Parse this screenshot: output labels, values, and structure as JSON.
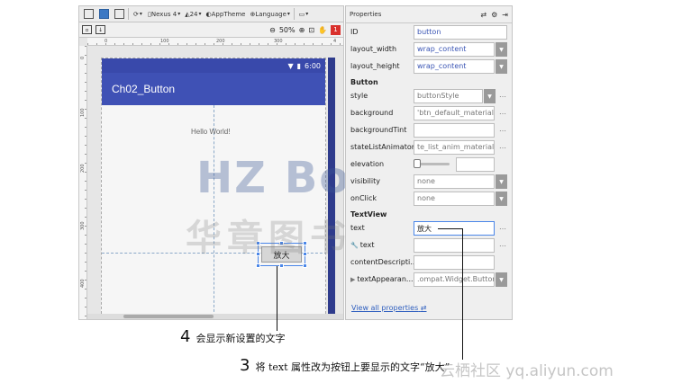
{
  "toolbar": {
    "device": "Nexus 4",
    "api": "24",
    "theme": "AppTheme",
    "language": "Language",
    "zoom": "50%",
    "error_count": "1"
  },
  "rulers": {
    "top": [
      "0",
      "100",
      "200",
      "300",
      "4"
    ],
    "left": [
      "0",
      "100",
      "200",
      "300",
      "400"
    ]
  },
  "preview": {
    "status_time": "6:00",
    "app_title": "Ch02_Button",
    "hello_text": "Hello World!",
    "button_text": "放大"
  },
  "watermark": {
    "line1": "HZ Books",
    "line2": "华章图书"
  },
  "properties": {
    "title": "Properties",
    "id_label": "ID",
    "id_value": "button",
    "layout_width_label": "layout_width",
    "layout_width_value": "wrap_content",
    "layout_height_label": "layout_height",
    "layout_height_value": "wrap_content",
    "section_button": "Button",
    "style_label": "style",
    "style_value": "buttonStyle",
    "background_label": "background",
    "background_value": "'btn_default_material",
    "backgroundtint_label": "backgroundTint",
    "statelistanimator_label": "stateListAnimator",
    "statelistanimator_value": "te_list_anim_material",
    "elevation_label": "elevation",
    "visibility_label": "visibility",
    "visibility_value": "none",
    "onclick_label": "onClick",
    "onclick_value": "none",
    "section_textview": "TextView",
    "text_label": "text",
    "text_value": "放大",
    "tools_text_label": "text",
    "contentdesc_label": "contentDescripti...",
    "textappearance_label": "textAppearan...",
    "textappearance_value": ".ompat.Widget.Button",
    "view_all": "View all properties"
  },
  "annotations": {
    "a4_num": "4",
    "a4_text": "会显示新设置的文字",
    "a3_num": "3",
    "a3_text": "将 text 属性改为按钮上要显示的文字“放大”"
  },
  "footer_watermark": "云栖社区 yq.aliyun.com",
  "colors": {
    "appbar": "#3f51b5",
    "statusbar": "#3949ab",
    "selection": "#4a86e8",
    "link": "#2f5fbf"
  }
}
